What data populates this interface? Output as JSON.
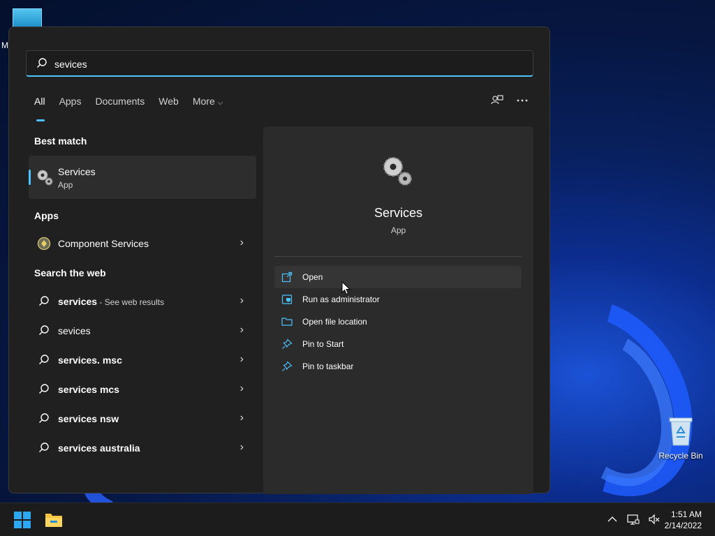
{
  "desktop": {
    "partial_label": "M",
    "recycle_bin_label": "Recycle Bin"
  },
  "search": {
    "query": "sevices",
    "icon": "search-icon"
  },
  "tabs": [
    {
      "label": "All",
      "active": true
    },
    {
      "label": "Apps"
    },
    {
      "label": "Documents"
    },
    {
      "label": "Web"
    },
    {
      "label": "More"
    }
  ],
  "sections": {
    "best_match": "Best match",
    "apps": "Apps",
    "search_web": "Search the web"
  },
  "best_match": {
    "name": "Services",
    "type": "App",
    "icon": "gears-icon"
  },
  "apps": [
    {
      "name": "Component Services",
      "icon": "component-services-icon"
    }
  ],
  "web_results": [
    {
      "bold": "services",
      "suffix": " - See web results"
    },
    {
      "bold": "",
      "plain": "sevices"
    },
    {
      "bold": "services. msc"
    },
    {
      "bold": "services mcs"
    },
    {
      "bold": "services nsw"
    },
    {
      "bold": "services australia"
    }
  ],
  "preview": {
    "title": "Services",
    "subtitle": "App",
    "actions": [
      {
        "label": "Open",
        "icon": "open-external-icon"
      },
      {
        "label": "Run as administrator",
        "icon": "shield-window-icon"
      },
      {
        "label": "Open file location",
        "icon": "folder-icon"
      },
      {
        "label": "Pin to Start",
        "icon": "pin-icon"
      },
      {
        "label": "Pin to taskbar",
        "icon": "pin-icon"
      }
    ]
  },
  "taskbar": {
    "time": "1:51 AM",
    "date": "2/14/2022"
  },
  "colors": {
    "accent": "#4cc2ff",
    "panel": "#202020",
    "preview": "#2b2b2b"
  }
}
